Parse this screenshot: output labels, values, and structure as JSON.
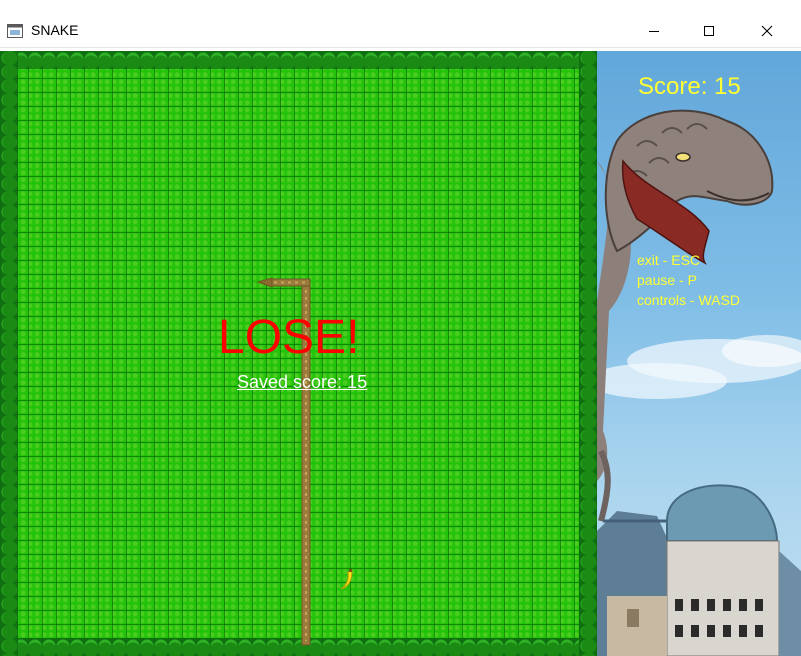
{
  "window": {
    "title": "SNAKE"
  },
  "game": {
    "status_text": "LOSE!",
    "saved_score_text": "Saved score: 15",
    "food_icon": "banana-icon"
  },
  "panel": {
    "score_text": "Score: 15",
    "controls": [
      "exit - ESC",
      "pause - P",
      "controls - WASD"
    ]
  },
  "colors": {
    "lose": "#ff0000",
    "saved_score": "#ffffff",
    "score": "#ffff33",
    "grass": "#23c20b",
    "snake": "#9a7b3c"
  }
}
